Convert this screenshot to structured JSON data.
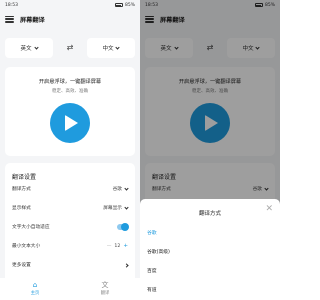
{
  "status_bar": {
    "time": "18:53",
    "battery": "85%"
  },
  "app": {
    "title": "屏幕翻译"
  },
  "lang": {
    "source": "英文",
    "target": "中文",
    "swap_glyph": "⇄"
  },
  "main_card": {
    "headline": "开启悬浮球，一键翻译屏幕",
    "sub": "稳定、高效、准确"
  },
  "settings": {
    "title": "翻译设置",
    "rows": [
      {
        "label": "翻译方式",
        "value": "谷歌"
      },
      {
        "label": "显示样式",
        "value": "屏幕显示"
      },
      {
        "label": "文字大小自动适应"
      },
      {
        "label": "最小文本大小",
        "value": "12"
      },
      {
        "label": "更多设置"
      }
    ],
    "toggle_on": true
  },
  "nav": [
    {
      "label": "主页",
      "glyph": "⌂",
      "active": true
    },
    {
      "label": "翻译",
      "glyph": "文",
      "active": false
    }
  ],
  "sheet": {
    "title": "翻译方式",
    "close_glyph": "✕",
    "options": [
      {
        "label": "谷歌",
        "selected": true
      },
      {
        "label": "谷歌(高级)",
        "selected": false
      },
      {
        "label": "百度",
        "selected": false
      },
      {
        "label": "有道",
        "selected": false
      }
    ]
  },
  "colors": {
    "accent": "#1f9bde",
    "background": "#f4f5f7"
  }
}
